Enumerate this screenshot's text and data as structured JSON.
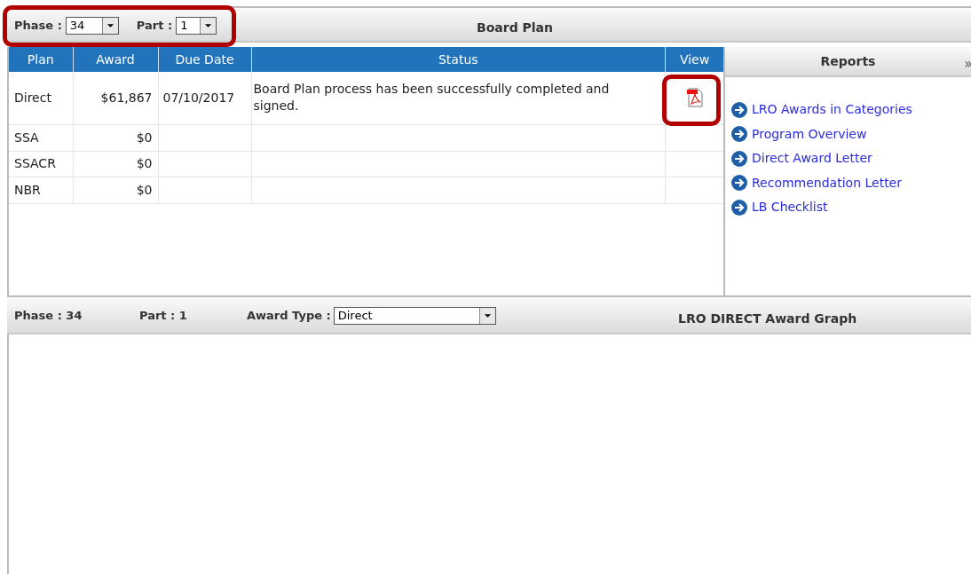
{
  "toolbar": {
    "phase_label": "Phase :",
    "phase_value": "34",
    "part_label": "Part :",
    "part_value": "1",
    "title": "Board Plan"
  },
  "table": {
    "columns": [
      "Plan",
      "Award",
      "Due Date",
      "Status",
      "View"
    ],
    "rows": [
      {
        "plan": "Direct",
        "award": "$61,867",
        "due_date": "07/10/2017",
        "status": "Board Plan process has been successfully completed and signed.",
        "has_pdf": true
      },
      {
        "plan": "SSA",
        "award": "$0",
        "has_pdf": false
      },
      {
        "plan": "SSACR",
        "award": "$0",
        "has_pdf": false
      },
      {
        "plan": "NBR",
        "award": "$0",
        "has_pdf": false
      }
    ]
  },
  "reports": {
    "title": "Reports",
    "collapse": "»",
    "links": [
      "LRO Awards in Categories",
      "Program Overview",
      "Direct Award Letter",
      "Recommendation Letter",
      "LB Checklist"
    ]
  },
  "graph_bar": {
    "phase": "Phase : 34",
    "part": "Part : 1",
    "award_type_label": "Award Type :",
    "award_type_value": "Direct",
    "title": "LRO DIRECT Award Graph"
  }
}
